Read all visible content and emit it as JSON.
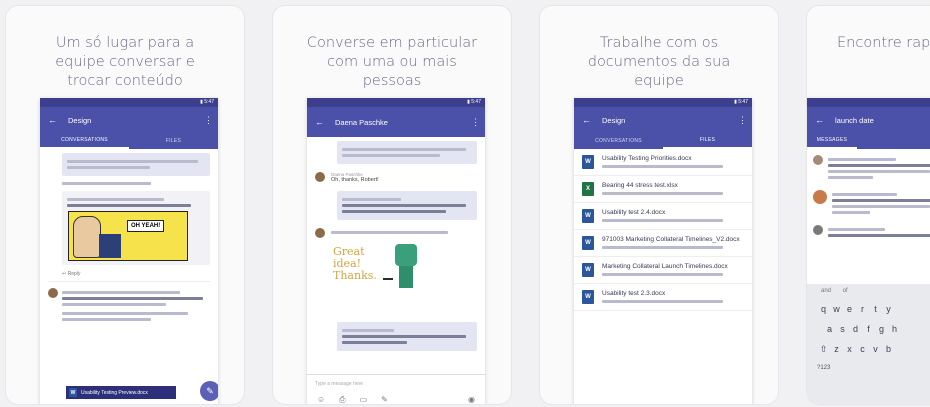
{
  "cards": [
    {
      "caption": "Um só lugar para a equipe conversar e trocar conteúdo",
      "app_title": "Design",
      "tab_conversations": "CONVERSATIONS",
      "tab_files": "FILES",
      "comic_text": "OH YEAH!",
      "reply_label": "Reply",
      "file_banner": "Usability Testing Preview.docx"
    },
    {
      "caption": "Converse em particular com uma ou mais pessoas",
      "app_title": "Daena Paschke",
      "sender_1": "Daena Paschke",
      "msg_1": "Oh, thanks, Robert!",
      "sticker_text": "Great idea! Thanks.",
      "input_placeholder": "Type a message here"
    },
    {
      "caption": "Trabalhe com os documentos da sua equipe",
      "app_title": "Design",
      "tab_conversations": "CONVERSATIONS",
      "tab_files": "FILES",
      "files": [
        {
          "name": "Usability Testing Priorities.docx",
          "type": "W"
        },
        {
          "name": "Bearing 44 stress test.xlsx",
          "type": "X"
        },
        {
          "name": "Usability test 2.4.docx",
          "type": "W"
        },
        {
          "name": "971003 Marketing Collateral Timelines_V2.docx",
          "type": "W"
        },
        {
          "name": "Marketing Collateral Launch Timelines.docx",
          "type": "W"
        },
        {
          "name": "Usability test 2.3.docx",
          "type": "W"
        }
      ]
    },
    {
      "caption": "Encontre rapida o que prec",
      "app_title": "launch date",
      "tab_messages": "MESSAGES",
      "keyboard_rows": [
        [
          "q",
          "w",
          "e",
          "r",
          "t",
          "y"
        ],
        [
          "a",
          "s",
          "d",
          "f",
          "g",
          "h"
        ],
        [
          "z",
          "x",
          "c",
          "v",
          "b"
        ]
      ],
      "kbd_symbol": "?123"
    }
  ],
  "colors": {
    "accent": "#4b51a8",
    "word": "#2b579a",
    "excel": "#217346"
  }
}
